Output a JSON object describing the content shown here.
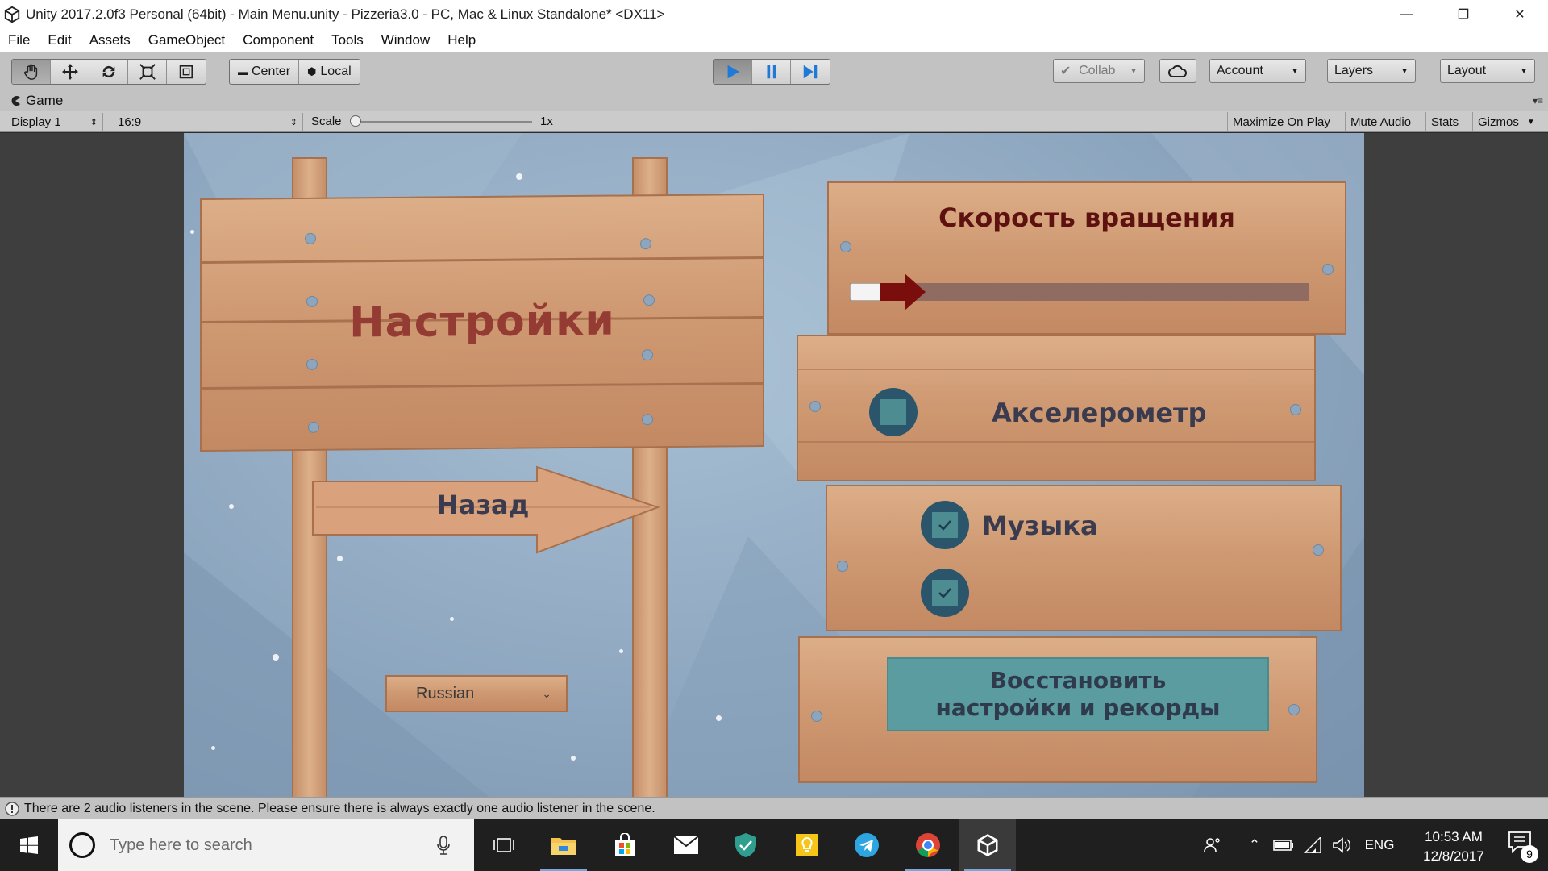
{
  "window": {
    "title": "Unity 2017.2.0f3 Personal (64bit) - Main Menu.unity - Pizzeria3.0 - PC, Mac & Linux Standalone* <DX11>",
    "controls": {
      "minimize": "—",
      "restore": "❐",
      "close": "✕"
    }
  },
  "menu": {
    "items": [
      "File",
      "Edit",
      "Assets",
      "GameObject",
      "Component",
      "Tools",
      "Window",
      "Help"
    ]
  },
  "toolbar": {
    "pivot": {
      "center_label": "Center",
      "local_label": "Local"
    },
    "collab_label": "Collab",
    "account_label": "Account",
    "layers_label": "Layers",
    "layout_label": "Layout"
  },
  "game_view": {
    "tab_label": "Game",
    "display": "Display 1",
    "aspect": "16:9",
    "scale_label": "Scale",
    "scale_value": "1x",
    "scale_level": 0,
    "maximize_on_play": "Maximize On Play",
    "mute_audio": "Mute Audio",
    "stats": "Stats",
    "gizmos": "Gizmos"
  },
  "game": {
    "settings_title": "Настройки",
    "back_label": "Назад",
    "language": "Russian",
    "rotation_title": "Скорость вращения",
    "rotation_speed_level": 0.04,
    "accelerometer_label": "Акселерометр",
    "accelerometer_checked": false,
    "music_label": "Музыка",
    "music_checked": true,
    "sound_checked": true,
    "reset_line1": "Восстановить",
    "reset_line2": "настройки и рекорды"
  },
  "status": {
    "message": "There are 2 audio listeners in the scene. Please ensure there is always exactly one audio listener in the scene."
  },
  "taskbar": {
    "search_placeholder": "Type here to search",
    "language": "ENG",
    "time": "10:53 AM",
    "date": "12/8/2017",
    "notification_count": "9"
  },
  "colors": {
    "play_blue": "#1e7ad6",
    "title_red": "#943b33",
    "rotation_title": "#5e1210",
    "toggle_teal": "#2a556b",
    "reset_teal": "#5a9ca0"
  }
}
